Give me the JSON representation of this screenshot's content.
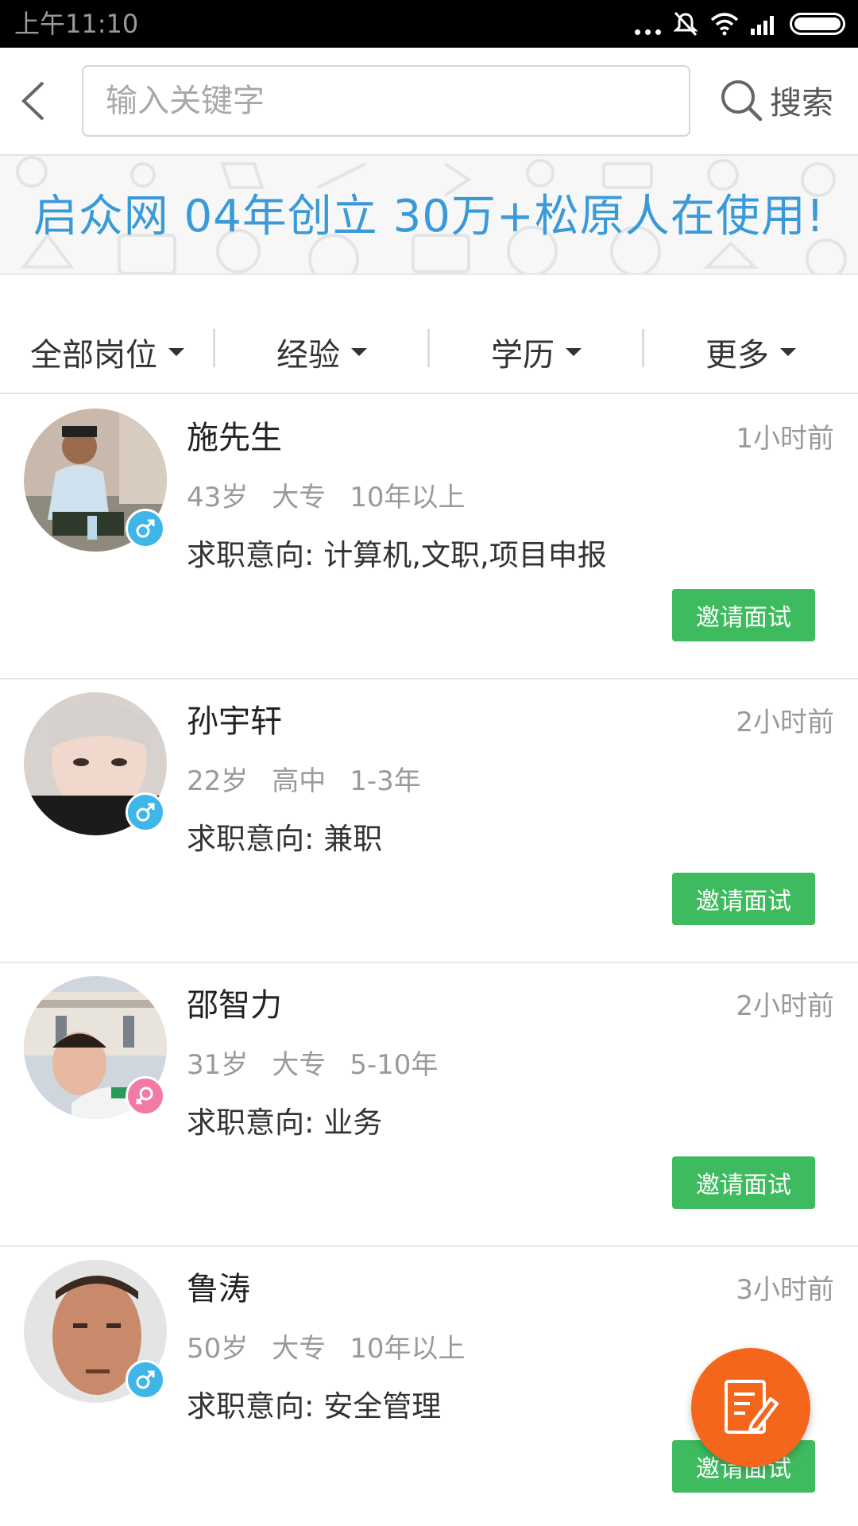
{
  "status_bar": {
    "time": "上午11:10"
  },
  "header": {
    "search_placeholder": "输入关键字",
    "search_label": "搜索"
  },
  "banner": {
    "slogan": "启众网 04年创立 30万+松原人在使用!"
  },
  "filters": [
    {
      "label": "全部岗位"
    },
    {
      "label": "经验"
    },
    {
      "label": "学历"
    },
    {
      "label": "更多"
    }
  ],
  "candidates": [
    {
      "name": "施先生",
      "time": "1小时前",
      "age": "43岁",
      "education": "大专",
      "experience": "10年以上",
      "intent": "求职意向: 计算机,文职,项目申报",
      "gender": "male",
      "invite_label": "邀请面试"
    },
    {
      "name": "孙宇轩",
      "time": "2小时前",
      "age": "22岁",
      "education": "高中",
      "experience": "1-3年",
      "intent": "求职意向: 兼职",
      "gender": "male",
      "invite_label": "邀请面试"
    },
    {
      "name": "邵智力",
      "time": "2小时前",
      "age": "31岁",
      "education": "大专",
      "experience": "5-10年",
      "intent": "求职意向: 业务",
      "gender": "female",
      "invite_label": "邀请面试"
    },
    {
      "name": "鲁涛",
      "time": "3小时前",
      "age": "50岁",
      "education": "大专",
      "experience": "10年以上",
      "intent": "求职意向: 安全管理",
      "gender": "male",
      "invite_label": "邀请面试"
    }
  ],
  "colors": {
    "accent_green": "#3dbb5e",
    "banner_text": "#3a9ad8",
    "fab": "#f5661d",
    "male": "#3fb6e8",
    "female": "#f17aa6"
  }
}
